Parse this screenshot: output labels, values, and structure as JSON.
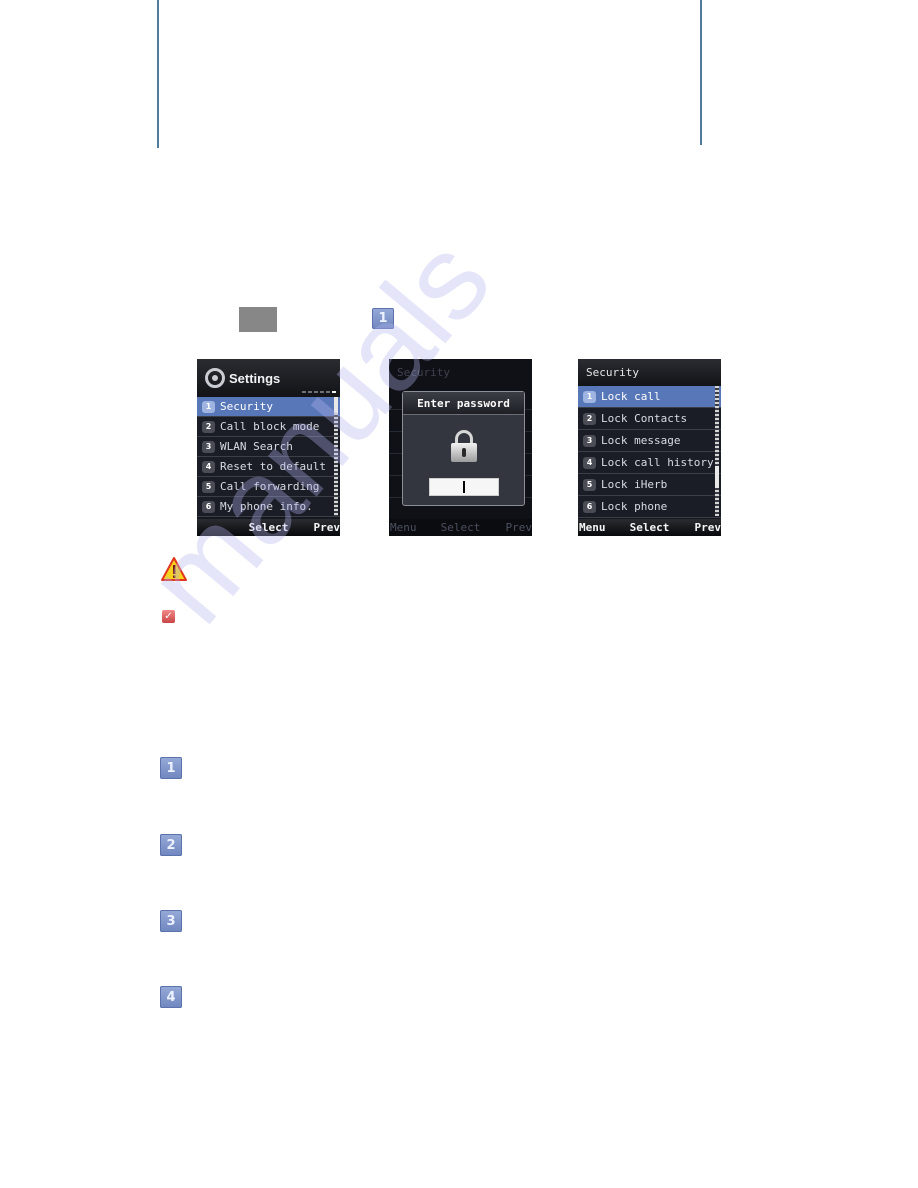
{
  "instruction": {
    "menu_key_label": "",
    "step_badge": "1"
  },
  "screens": [
    {
      "title": "Settings",
      "items": [
        {
          "num": "1",
          "label": "Security",
          "selected": true
        },
        {
          "num": "2",
          "label": "Call block mode"
        },
        {
          "num": "3",
          "label": "WLAN Search"
        },
        {
          "num": "4",
          "label": "Reset to default"
        },
        {
          "num": "5",
          "label": "Call forwarding"
        },
        {
          "num": "6",
          "label": "My phone info."
        }
      ],
      "softkeys": {
        "left": "",
        "center": "Select",
        "right": "Prev"
      }
    },
    {
      "background_title": "Security",
      "dialog_title": "Enter password",
      "password_value": "",
      "softkeys": {
        "left": "Menu",
        "center": "Select",
        "right": "Prev"
      }
    },
    {
      "title": "Security",
      "items": [
        {
          "num": "1",
          "label": "Lock call",
          "selected": true
        },
        {
          "num": "2",
          "label": "Lock Contacts"
        },
        {
          "num": "3",
          "label": "Lock message"
        },
        {
          "num": "4",
          "label": "Lock call history"
        },
        {
          "num": "5",
          "label": "Lock iHerb"
        },
        {
          "num": "6",
          "label": "Lock phone"
        }
      ],
      "softkeys": {
        "left": "Menu",
        "center": "Select",
        "right": "Prev"
      }
    }
  ],
  "icons": {
    "warning": "warning-triangle-icon",
    "note": "checkbox-note-icon"
  },
  "step_badges": [
    "1",
    "2",
    "3",
    "4"
  ],
  "watermark": "manuals",
  "colors": {
    "rule": "#4f7c9a",
    "badge": "#7c92c8",
    "selection": "#5877b8",
    "screen_bg": "#15181f"
  }
}
